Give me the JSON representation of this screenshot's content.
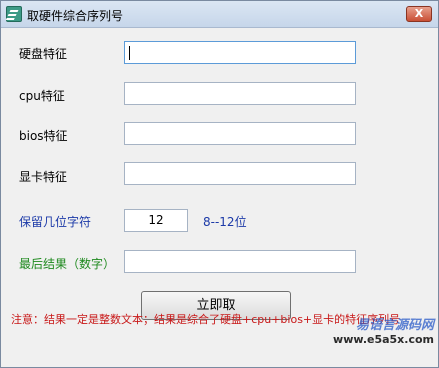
{
  "window": {
    "title": "取硬件综合序列号",
    "close_label": "X"
  },
  "fields": {
    "disk": {
      "label": "硬盘特征",
      "value": ""
    },
    "cpu": {
      "label": "cpu特征",
      "value": ""
    },
    "bios": {
      "label": "bios特征",
      "value": ""
    },
    "gpu": {
      "label": "显卡特征",
      "value": ""
    },
    "digits": {
      "label": "保留几位字符",
      "value": "12",
      "hint": "8--12位"
    },
    "result": {
      "label": "最后结果（数字）",
      "value": ""
    }
  },
  "button": {
    "label": "立即取"
  },
  "note": "注意：结果一定是整数文本；结果是综合了硬盘+cpu+bios+显卡的特征序列号",
  "watermark": {
    "text": "易语言源码网",
    "url": "www.e5a5x.com"
  },
  "colors": {
    "blue_label": "#1c3aa8",
    "green_label": "#1f8a1f",
    "note_red": "#c81818"
  },
  "icons": {
    "app": "app-icon",
    "close": "close-icon"
  }
}
